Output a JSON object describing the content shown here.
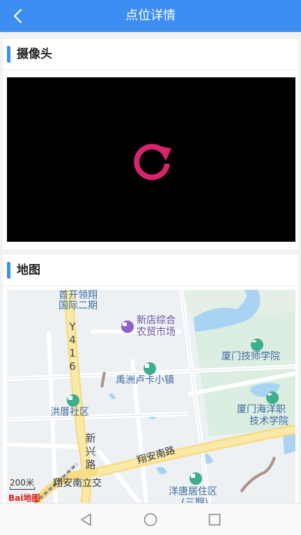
{
  "header": {
    "title": "点位详情",
    "back_icon": "chevron-left-icon"
  },
  "camera": {
    "section_title": "摄像头",
    "reload_icon": "reload-icon",
    "reload_color": "#d6246e"
  },
  "map": {
    "section_title": "地图",
    "labels": {
      "shoukai_1": "首开领翔",
      "shoukai_2": "国际二期",
      "xindian_1": "新店综合",
      "xindian_2": "农贸市场",
      "jishi": "厦门技师学院",
      "yuzhou": "禹洲卢卡小镇",
      "hongcuo": "洪厝社区",
      "haiyang_1": "厦门海洋职",
      "haiyang_2": "技术学院",
      "xiangan_nan_lu": "翔安南路",
      "xiangan_nan_lijiao": "翔安南立交",
      "yangtang_1": "洋唐居住区",
      "yangtang_2": "(三期)",
      "road_y416": "Y416",
      "road_xinxing": "新兴路"
    },
    "scale_text": "200米",
    "logo_text": "Bai地图"
  },
  "nav": {
    "back": "triangle-back-icon",
    "home": "circle-home-icon",
    "recent": "square-recent-icon"
  }
}
